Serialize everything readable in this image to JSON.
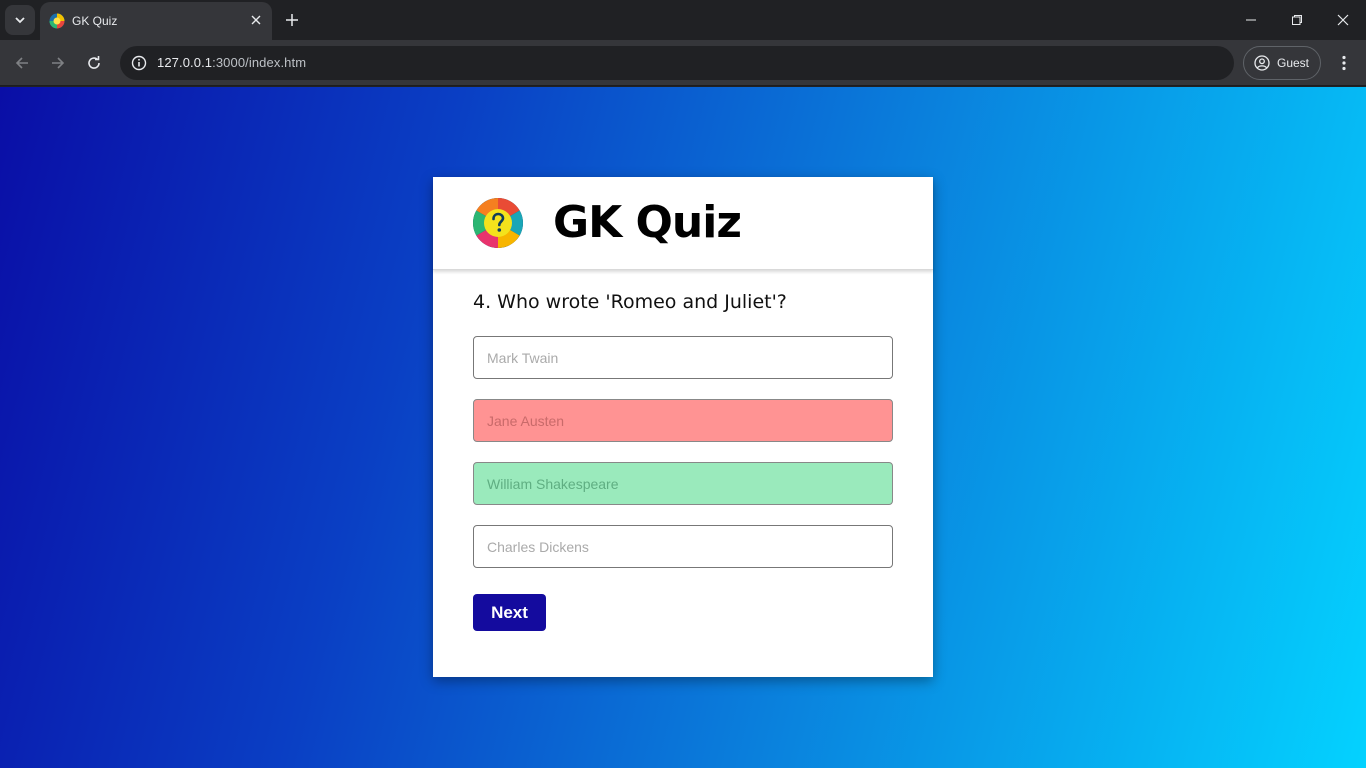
{
  "browser": {
    "tab_title": "GK Quiz",
    "url_host": "127.0.0.1",
    "url_path": ":3000/index.htm",
    "profile_label": "Guest"
  },
  "quiz": {
    "title": "GK Quiz",
    "question": "4. Who wrote 'Romeo and Juliet'?",
    "options": [
      {
        "label": "Mark Twain",
        "state": "neutral"
      },
      {
        "label": "Jane Austen",
        "state": "wrong"
      },
      {
        "label": "William Shakespeare",
        "state": "correct"
      },
      {
        "label": "Charles Dickens",
        "state": "neutral"
      }
    ],
    "next_label": "Next"
  },
  "colors": {
    "wrong": "#ff9393",
    "correct": "#9aeabc",
    "next_button": "#140b9e",
    "gradient_start": "#0a0ea6",
    "gradient_end": "#04d2ff"
  },
  "icons": [
    "tab-search-icon",
    "favicon-icon",
    "close-icon",
    "plus-icon",
    "minimize-icon",
    "restore-icon",
    "back-icon",
    "forward-icon",
    "reload-icon",
    "site-info-icon",
    "profile-icon",
    "kebab-menu-icon",
    "quiz-logo-icon"
  ]
}
